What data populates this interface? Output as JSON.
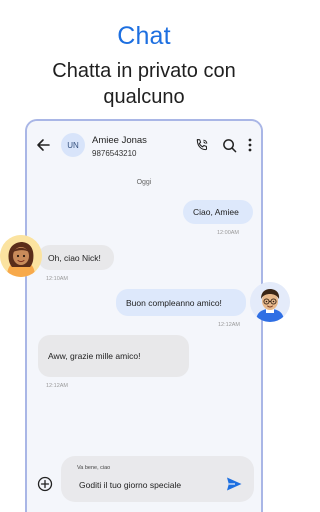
{
  "promo": {
    "title": "Chat",
    "subtitle_line1": "Chatta in privato con",
    "subtitle_line2": "qualcuno"
  },
  "header": {
    "avatar_initials": "UN",
    "contact_name": "Amiee Jonas",
    "contact_phone": "9876543210",
    "icons": [
      "back-icon",
      "call-icon",
      "search-icon",
      "more-icon"
    ]
  },
  "conversation": {
    "date_label": "Oggi",
    "messages": [
      {
        "direction": "out",
        "text": "Ciao, Amiee",
        "time": "12:00AM"
      },
      {
        "direction": "in",
        "text": "Oh, ciao Nick!",
        "time": "12:10AM"
      },
      {
        "direction": "out",
        "text": "Buon compleanno amico!",
        "time": "12:12AM"
      },
      {
        "direction": "in",
        "text": "Aww, grazie mille amico!",
        "time": "12:12AM"
      }
    ]
  },
  "composer": {
    "reply_preview": "Va bene, ciao",
    "input_value": "Goditi il tuo giorno speciale"
  },
  "colors": {
    "accent": "#1d6fe0",
    "outgoing_bubble": "#dde8fb",
    "incoming_bubble": "#e8e8ea",
    "phone_frame": "#a9b6e6"
  }
}
